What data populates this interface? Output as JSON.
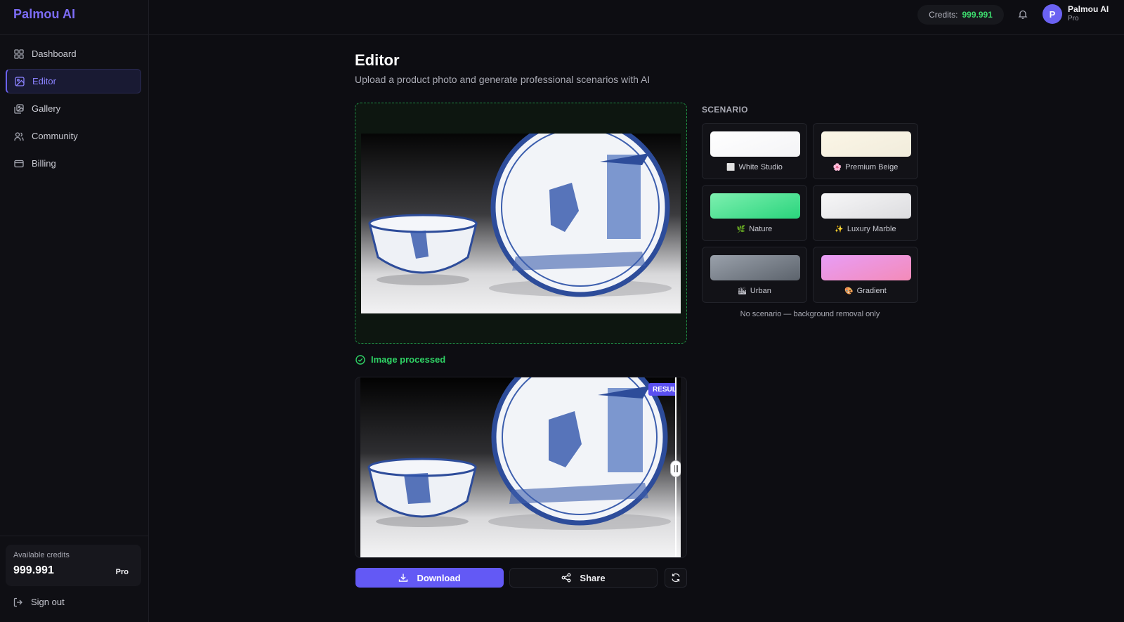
{
  "app": {
    "brand": "Palmou AI"
  },
  "sidebar": {
    "items": [
      {
        "label": "Dashboard",
        "icon": "dashboard-icon",
        "active": false
      },
      {
        "label": "Editor",
        "icon": "image-icon",
        "active": true
      },
      {
        "label": "Gallery",
        "icon": "gallery-icon",
        "active": false
      },
      {
        "label": "Community",
        "icon": "users-icon",
        "active": false
      },
      {
        "label": "Billing",
        "icon": "credit-card-icon",
        "active": false
      }
    ],
    "credits": {
      "label": "Available credits",
      "value": "999.991",
      "plan": "Pro"
    },
    "signout": "Sign out"
  },
  "topbar": {
    "credits_label": "Credits:",
    "credits_value": "999.991",
    "user": {
      "initial": "P",
      "name": "Palmou AI",
      "plan": "Pro"
    }
  },
  "main": {
    "title": "Editor",
    "subtitle": "Upload a product photo and generate professional scenarios with AI",
    "status": "Image processed",
    "result_tag": "RESULT",
    "actions": {
      "download": "Download",
      "share": "Share"
    }
  },
  "scenario": {
    "title": "SCENARIO",
    "options": [
      {
        "label": "White Studio",
        "emoji": "⬜",
        "color_from": "#ffffff",
        "color_to": "#f4f4f6"
      },
      {
        "label": "Premium Beige",
        "emoji": "🌸",
        "color_from": "#fbf6e6",
        "color_to": "#f1ecdc"
      },
      {
        "label": "Nature",
        "emoji": "🌿",
        "color_from": "#7ef0b0",
        "color_to": "#29d47c"
      },
      {
        "label": "Luxury Marble",
        "emoji": "✨",
        "color_from": "#f7f7f8",
        "color_to": "#dcdcdf"
      },
      {
        "label": "Urban",
        "emoji": "🏙",
        "color_from": "#9aa1ab",
        "color_to": "#5c636c"
      },
      {
        "label": "Gradient",
        "emoji": "🎨",
        "color_from": "#e89df7",
        "color_to": "#f48bb8"
      }
    ],
    "none_text": "No scenario — background removal only"
  },
  "colors": {
    "accent": "#6359f5",
    "success": "#2fd365",
    "credits": "#3ddc6e"
  }
}
